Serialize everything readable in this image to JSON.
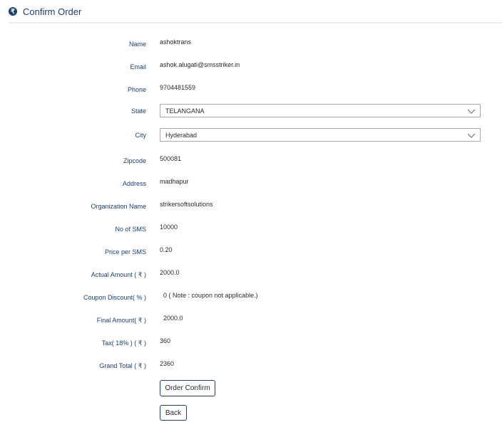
{
  "header": {
    "icon": "rupee-icon",
    "title": "Confirm Order",
    "accent": "#1c3f6e"
  },
  "form": {
    "name_label": "Name",
    "name_value": "ashoktrans",
    "email_label": "Email",
    "email_value": "ashok.alugati@smsstriker.in",
    "phone_label": "Phone",
    "phone_value": "9704481559",
    "state_label": "State",
    "state_value": "TELANGANA",
    "city_label": "City",
    "city_value": "Hyderabad",
    "zipcode_label": "Zipcode",
    "zipcode_value": "500081",
    "address_label": "Address",
    "address_value": "madhapur",
    "org_label": "Organization Name",
    "org_value": "strikersoftsolutions",
    "sms_label": "No of SMS",
    "sms_value": "10000",
    "price_label": "Price per SMS",
    "price_value": "0.20",
    "actual_label": "Actual Amount ( ₹ )",
    "actual_value": "2000.0",
    "coupon_label": "Coupon Discount( % )",
    "coupon_value": "0 ( Note : coupon not applicable.)",
    "final_label": "Final Amount( ₹ )",
    "final_value": "2000.0",
    "tax_label": "Tax( 18% ) ( ₹ )",
    "tax_value": "360",
    "grand_label": "Grand Total ( ₹ )",
    "grand_value": "2360"
  },
  "buttons": {
    "confirm": "Order Confirm",
    "back": "Back"
  }
}
